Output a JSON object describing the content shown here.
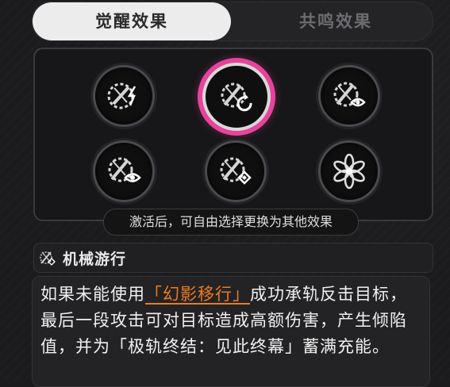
{
  "tabs": {
    "active": "觉醒效果",
    "inactive": "共鸣效果"
  },
  "nodes": [
    {
      "icon": "mech-lightning-icon",
      "selected": false
    },
    {
      "icon": "mech-spin-icon",
      "selected": true
    },
    {
      "icon": "mech-eye-icon",
      "selected": false
    },
    {
      "icon": "mech-eye-alt-icon",
      "selected": false
    },
    {
      "icon": "mech-diamond-icon",
      "selected": false
    },
    {
      "icon": "flower-icon",
      "selected": false
    }
  ],
  "colors": {
    "selected_ring": "#e8439c",
    "highlight": "#f07a1f"
  },
  "hint": "激活后，可自由选择更换为其他效果",
  "effect": {
    "name": "机械游行",
    "desc_pre": "如果未能使用",
    "desc_skill": "「幻影移行」",
    "desc_post": "成功承轨反击目标，最后一段攻击可对目标造成高额伤害，产生倾陷值，并为「极轨终结：见此终幕」蓄满充能。"
  }
}
